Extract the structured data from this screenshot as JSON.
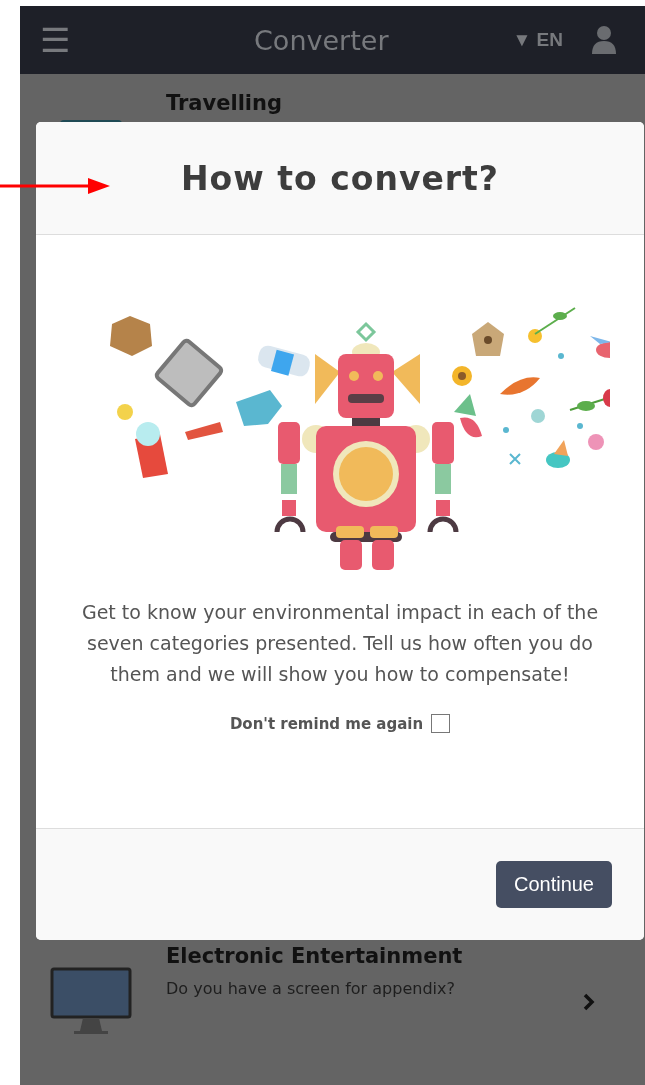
{
  "top_bar": {
    "menu_icon": "☰",
    "title": "Converter",
    "language": "▼ EN"
  },
  "categories": [
    {
      "title": "Travelling",
      "kind": "travel"
    },
    {
      "title": "Electronic Entertainment",
      "subtitle": "Do you have a screen for appendix?",
      "kind": "monitor"
    }
  ],
  "dialog": {
    "title": "How to convert?",
    "text": "Get to know your environmental impact in each of the seven categories presented. Tell us how often you do them and we will show you how to compensate!",
    "remind_label": "Don't remind me again",
    "remind_checked": false,
    "button": "Continue"
  }
}
